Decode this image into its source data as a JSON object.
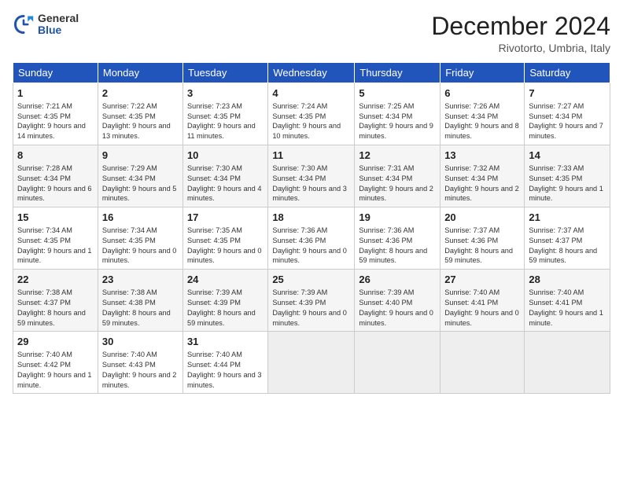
{
  "header": {
    "logo_general": "General",
    "logo_blue": "Blue",
    "title": "December 2024",
    "subtitle": "Rivotorto, Umbria, Italy"
  },
  "weekdays": [
    "Sunday",
    "Monday",
    "Tuesday",
    "Wednesday",
    "Thursday",
    "Friday",
    "Saturday"
  ],
  "weeks": [
    [
      {
        "day": "1",
        "info": "Sunrise: 7:21 AM\nSunset: 4:35 PM\nDaylight: 9 hours and 14 minutes."
      },
      {
        "day": "2",
        "info": "Sunrise: 7:22 AM\nSunset: 4:35 PM\nDaylight: 9 hours and 13 minutes."
      },
      {
        "day": "3",
        "info": "Sunrise: 7:23 AM\nSunset: 4:35 PM\nDaylight: 9 hours and 11 minutes."
      },
      {
        "day": "4",
        "info": "Sunrise: 7:24 AM\nSunset: 4:35 PM\nDaylight: 9 hours and 10 minutes."
      },
      {
        "day": "5",
        "info": "Sunrise: 7:25 AM\nSunset: 4:34 PM\nDaylight: 9 hours and 9 minutes."
      },
      {
        "day": "6",
        "info": "Sunrise: 7:26 AM\nSunset: 4:34 PM\nDaylight: 9 hours and 8 minutes."
      },
      {
        "day": "7",
        "info": "Sunrise: 7:27 AM\nSunset: 4:34 PM\nDaylight: 9 hours and 7 minutes."
      }
    ],
    [
      {
        "day": "8",
        "info": "Sunrise: 7:28 AM\nSunset: 4:34 PM\nDaylight: 9 hours and 6 minutes."
      },
      {
        "day": "9",
        "info": "Sunrise: 7:29 AM\nSunset: 4:34 PM\nDaylight: 9 hours and 5 minutes."
      },
      {
        "day": "10",
        "info": "Sunrise: 7:30 AM\nSunset: 4:34 PM\nDaylight: 9 hours and 4 minutes."
      },
      {
        "day": "11",
        "info": "Sunrise: 7:30 AM\nSunset: 4:34 PM\nDaylight: 9 hours and 3 minutes."
      },
      {
        "day": "12",
        "info": "Sunrise: 7:31 AM\nSunset: 4:34 PM\nDaylight: 9 hours and 2 minutes."
      },
      {
        "day": "13",
        "info": "Sunrise: 7:32 AM\nSunset: 4:34 PM\nDaylight: 9 hours and 2 minutes."
      },
      {
        "day": "14",
        "info": "Sunrise: 7:33 AM\nSunset: 4:35 PM\nDaylight: 9 hours and 1 minute."
      }
    ],
    [
      {
        "day": "15",
        "info": "Sunrise: 7:34 AM\nSunset: 4:35 PM\nDaylight: 9 hours and 1 minute."
      },
      {
        "day": "16",
        "info": "Sunrise: 7:34 AM\nSunset: 4:35 PM\nDaylight: 9 hours and 0 minutes."
      },
      {
        "day": "17",
        "info": "Sunrise: 7:35 AM\nSunset: 4:35 PM\nDaylight: 9 hours and 0 minutes."
      },
      {
        "day": "18",
        "info": "Sunrise: 7:36 AM\nSunset: 4:36 PM\nDaylight: 9 hours and 0 minutes."
      },
      {
        "day": "19",
        "info": "Sunrise: 7:36 AM\nSunset: 4:36 PM\nDaylight: 8 hours and 59 minutes."
      },
      {
        "day": "20",
        "info": "Sunrise: 7:37 AM\nSunset: 4:36 PM\nDaylight: 8 hours and 59 minutes."
      },
      {
        "day": "21",
        "info": "Sunrise: 7:37 AM\nSunset: 4:37 PM\nDaylight: 8 hours and 59 minutes."
      }
    ],
    [
      {
        "day": "22",
        "info": "Sunrise: 7:38 AM\nSunset: 4:37 PM\nDaylight: 8 hours and 59 minutes."
      },
      {
        "day": "23",
        "info": "Sunrise: 7:38 AM\nSunset: 4:38 PM\nDaylight: 8 hours and 59 minutes."
      },
      {
        "day": "24",
        "info": "Sunrise: 7:39 AM\nSunset: 4:39 PM\nDaylight: 8 hours and 59 minutes."
      },
      {
        "day": "25",
        "info": "Sunrise: 7:39 AM\nSunset: 4:39 PM\nDaylight: 9 hours and 0 minutes."
      },
      {
        "day": "26",
        "info": "Sunrise: 7:39 AM\nSunset: 4:40 PM\nDaylight: 9 hours and 0 minutes."
      },
      {
        "day": "27",
        "info": "Sunrise: 7:40 AM\nSunset: 4:41 PM\nDaylight: 9 hours and 0 minutes."
      },
      {
        "day": "28",
        "info": "Sunrise: 7:40 AM\nSunset: 4:41 PM\nDaylight: 9 hours and 1 minute."
      }
    ],
    [
      {
        "day": "29",
        "info": "Sunrise: 7:40 AM\nSunset: 4:42 PM\nDaylight: 9 hours and 1 minute."
      },
      {
        "day": "30",
        "info": "Sunrise: 7:40 AM\nSunset: 4:43 PM\nDaylight: 9 hours and 2 minutes."
      },
      {
        "day": "31",
        "info": "Sunrise: 7:40 AM\nSunset: 4:44 PM\nDaylight: 9 hours and 3 minutes."
      },
      null,
      null,
      null,
      null
    ]
  ]
}
